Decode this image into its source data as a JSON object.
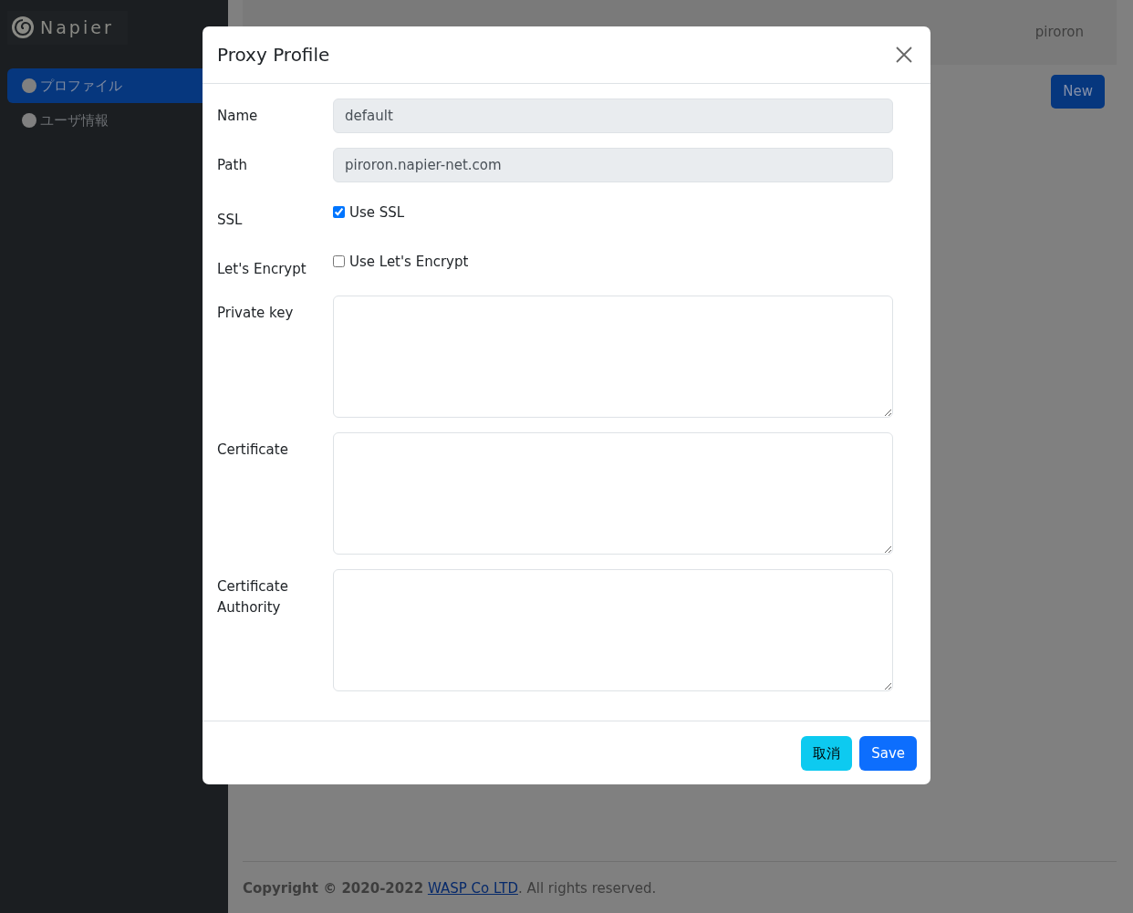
{
  "sidebar": {
    "brand": "Napier",
    "items": [
      {
        "label": "プロファイル",
        "selected": true
      },
      {
        "label": "ユーザ情報",
        "selected": false
      }
    ]
  },
  "header": {
    "user": "piroron"
  },
  "new_button": "New",
  "modal": {
    "title": "Proxy Profile",
    "fields": [
      {
        "kind": "text",
        "label": "Name",
        "value": "default",
        "disabled": true
      },
      {
        "kind": "text",
        "label": "Path",
        "value": "piroron.napier-net.com",
        "disabled": true
      },
      {
        "kind": "checkbox",
        "label": "SSL",
        "option": "Use SSL",
        "checked": true
      },
      {
        "kind": "checkbox",
        "label": "Let's Encrypt",
        "option": "Use Let's Encrypt",
        "checked": false
      },
      {
        "kind": "textarea",
        "label": "Private key"
      },
      {
        "kind": "textarea",
        "label": "Certificate"
      },
      {
        "kind": "textarea",
        "label": "Certificate Authority"
      }
    ],
    "buttons": [
      {
        "kind": "cancel",
        "label": "取消"
      },
      {
        "kind": "save",
        "label": "Save"
      }
    ]
  },
  "footer": {
    "copyright": "Copyright © 2020-2022",
    "link": "WASP Co LTD",
    "rest": ". All rights reserved."
  }
}
